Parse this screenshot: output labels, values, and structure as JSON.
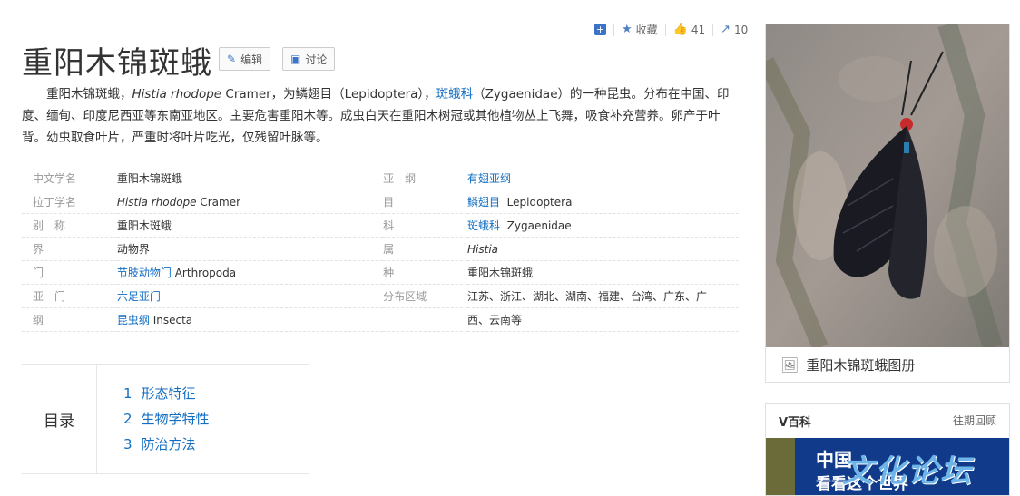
{
  "topbar": {
    "favorite_label": "收藏",
    "like_count": "41",
    "share_count": "10"
  },
  "title": "重阳木锦斑蛾",
  "buttons": {
    "edit": "编辑",
    "discuss": "讨论"
  },
  "summary": {
    "p1": "重阳木锦斑蛾，",
    "latin": "Histia rhodope",
    "p2": " Cramer，为鳞翅目（Lepidoptera），",
    "link": "斑蛾科",
    "p3": "（Zygaenidae）的一种昆虫。分布在中国、印度、缅甸、印度尼西亚等东南亚地区。主要危害重阳木等。成虫白天在重阳木树冠或其他植物丛上飞舞，吸食补充营养。卵产于叶背。幼虫取食叶片，严重时将叶片吃光，仅残留叶脉等。"
  },
  "infobox": {
    "left": [
      {
        "k": "中文学名",
        "v": "重阳木锦斑蛾"
      },
      {
        "k": "拉丁学名",
        "v_it": "Histia rhodope",
        "v": " Cramer"
      },
      {
        "k": "别　称",
        "v": "重阳木斑蛾"
      },
      {
        "k": "界",
        "v": "动物界"
      },
      {
        "k": "门",
        "v_link": "节肢动物门",
        "v": " Arthropoda"
      },
      {
        "k": "亚　门",
        "v_link": "六足亚门"
      },
      {
        "k": "纲",
        "v_link": "昆虫纲",
        "v": " Insecta"
      }
    ],
    "right": [
      {
        "k": "亚　纲",
        "v_link": "有翅亚纲"
      },
      {
        "k": "目",
        "v_link": "鳞翅目",
        "v": "  Lepidoptera"
      },
      {
        "k": "科",
        "v_link": "斑蛾科",
        "v": "  Zygaenidae"
      },
      {
        "k": "属",
        "v_it": "Histia"
      },
      {
        "k": "种",
        "v": "重阳木锦斑蛾"
      },
      {
        "k": "分布区域",
        "v": "江苏、浙江、湖北、湖南、福建、台湾、广东、广"
      },
      {
        "k": "",
        "v": "西、云南等"
      }
    ]
  },
  "toc": {
    "label": "目录",
    "items": [
      {
        "num": "1",
        "text": "形态特征"
      },
      {
        "num": "2",
        "text": "生物学特性"
      },
      {
        "num": "3",
        "text": "防治方法"
      }
    ]
  },
  "album": {
    "caption": "重阳木锦斑蛾图册"
  },
  "vbaike": {
    "title": "V百科",
    "past": "往期回顾",
    "banner_line1": "中国",
    "banner_line2": "看看这个世界",
    "watermark": "文化论坛"
  },
  "colors": {
    "link": "#136ec2",
    "accent": "#3b73c7"
  }
}
